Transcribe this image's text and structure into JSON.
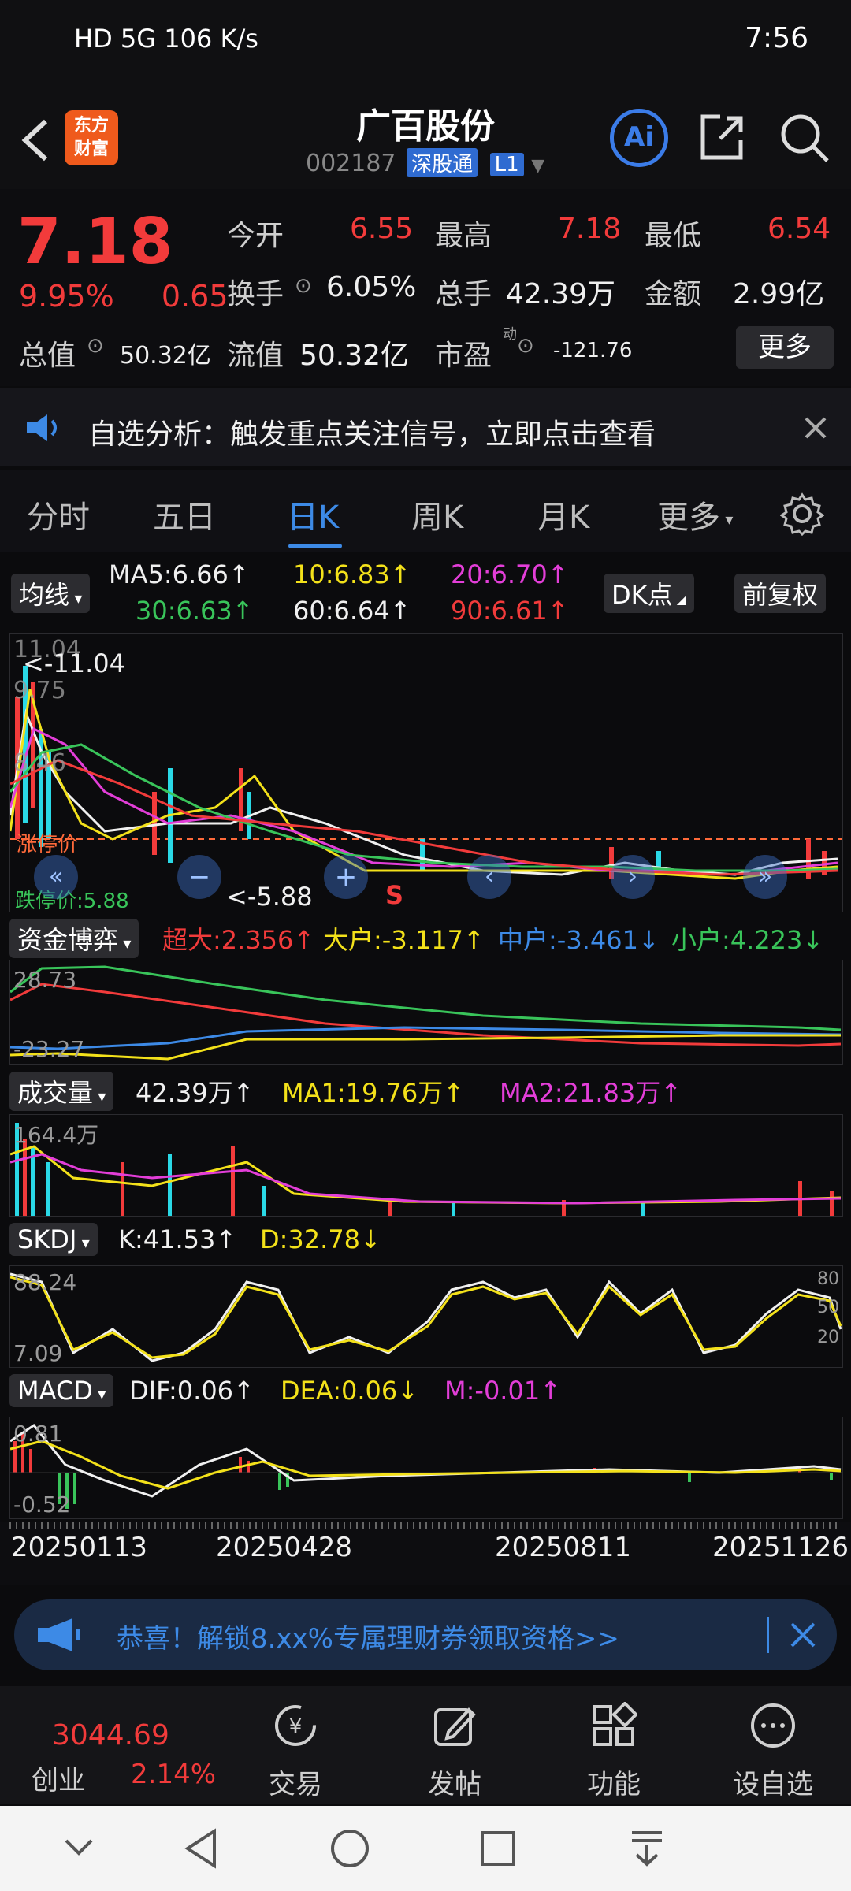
{
  "status_bar": {
    "left": "HD 5G 106 K/s",
    "time": "7:56"
  },
  "header": {
    "logo_line1": "东方",
    "logo_line2": "财富",
    "title": "广百股份",
    "code": "002187",
    "tag": "深股通",
    "tag_level": "L1",
    "ai_label": "Ai"
  },
  "quote": {
    "price": "7.18",
    "change_pct": "9.95%",
    "change": "0.65",
    "open_label": "今开",
    "open": "6.55",
    "high_label": "最高",
    "high": "7.18",
    "low_label": "最低",
    "low": "6.54",
    "turnover_label": "换手",
    "turnover": "6.05%",
    "volume_label": "总手",
    "volume": "42.39万",
    "amount_label": "金额",
    "amount": "2.99亿",
    "mktcap_label": "总值",
    "mktcap": "50.32亿",
    "float_label": "流值",
    "float": "50.32亿",
    "pe_label": "市盈",
    "pe_sup": "动",
    "pe": "-121.76",
    "more": "更多"
  },
  "banner": {
    "text": "自选分析：触发重点关注信号，立即点击查看"
  },
  "tabs": [
    "分时",
    "五日",
    "日K",
    "周K",
    "月K",
    "更多"
  ],
  "ma": {
    "chip": "均线",
    "ma5": "MA5:6.66↑",
    "ma10": "10:6.83↑",
    "ma20": "20:6.70↑",
    "ma30": "30:6.63↑",
    "ma60": "60:6.64↑",
    "ma90": "90:6.61↑",
    "dk": "DK点",
    "adjust": "前复权"
  },
  "kline": {
    "top_axis": "11.04",
    "max_marker": "<-11.04",
    "mid1": "9.75",
    "mid2": "8.46",
    "limit_up_label": "涨停价",
    "limit_down_label": "跌停价:5.88",
    "min_marker": "<-5.88",
    "s_marker": "S"
  },
  "fund": {
    "chip": "资金博弈",
    "super": "超大:2.356↑",
    "big": "大户:-3.117↑",
    "mid": "中户:-3.461↓",
    "small": "小户:4.223↓",
    "top": "28.73",
    "bottom": "-23.27"
  },
  "volume": {
    "chip": "成交量",
    "value": "42.39万↑",
    "ma1": "MA1:19.76万↑",
    "ma2": "MA2:21.83万↑",
    "top": "164.4万"
  },
  "skdj": {
    "chip": "SKDJ",
    "k": "K:41.53↑",
    "d": "D:32.78↓",
    "top": "88.24",
    "bottom": "7.09",
    "r80": "80",
    "r50": "50",
    "r20": "20"
  },
  "macd": {
    "chip": "MACD",
    "dif": "DIF:0.06↑",
    "dea": "DEA:0.06↓",
    "m": "M:-0.01↑",
    "top": "0.81",
    "bottom": "-0.52"
  },
  "dates": [
    "20250113",
    "20250428",
    "20250811",
    "20251126"
  ],
  "promo": {
    "text": "恭喜！解锁8.xx%专属理财券领取资格>>"
  },
  "bottom_nav": {
    "index_value": "3044.69",
    "index_name": "创业",
    "index_pct": "2.14%",
    "trade": "交易",
    "post": "发帖",
    "func": "功能",
    "watch": "设自选"
  },
  "colors": {
    "up": "#f23b3b",
    "down": "#39c45a",
    "accent": "#3d8ae6",
    "yellow": "#f3e11a",
    "magenta": "#e33ed8"
  }
}
